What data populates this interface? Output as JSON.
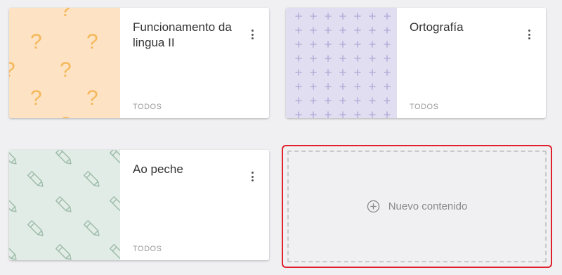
{
  "cards": [
    {
      "title": "Funcionamento da lingua II",
      "tag": "TODOS",
      "pattern_icon": "question-mark-pattern",
      "pattern_bg": "#fde3c3",
      "pattern_fg": "#f5b75a"
    },
    {
      "title": "Ortografía",
      "tag": "TODOS",
      "pattern_icon": "plus-pattern",
      "pattern_bg": "#e1def1",
      "pattern_fg": "#b7afd9"
    },
    {
      "title": "Ao peche",
      "tag": "TODOS",
      "pattern_icon": "pencil-pattern",
      "pattern_bg": "#e2ece6",
      "pattern_fg": "#9bbba8"
    }
  ],
  "add_content": {
    "label": "Nuevo contenido",
    "icon": "plus-circle-icon",
    "highlight_color": "#e0202c"
  },
  "menu_icon": "more-vert-icon"
}
